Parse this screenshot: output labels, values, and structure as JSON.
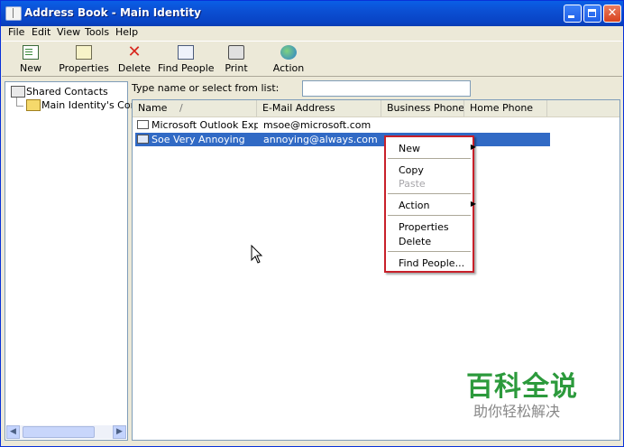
{
  "window": {
    "title": "Address Book - Main Identity"
  },
  "menubar": {
    "items": [
      "File",
      "Edit",
      "View",
      "Tools",
      "Help"
    ]
  },
  "toolbar": {
    "buttons": [
      {
        "label": "New",
        "icon": "new-contact-icon"
      },
      {
        "label": "Properties",
        "icon": "properties-icon"
      },
      {
        "label": "Delete",
        "icon": "delete-icon"
      },
      {
        "label": "Find People",
        "icon": "find-people-icon"
      },
      {
        "label": "Print",
        "icon": "print-icon"
      },
      {
        "label": "Action",
        "icon": "action-icon"
      }
    ]
  },
  "tree": {
    "items": [
      "Shared Contacts",
      "Main Identity's Conta"
    ]
  },
  "search": {
    "label": "Type name or select from list:",
    "value": ""
  },
  "list": {
    "columns": [
      "Name",
      "E-Mail Address",
      "Business Phone",
      "Home Phone"
    ],
    "sort_indicator": "/",
    "rows": [
      {
        "name": "Microsoft Outlook Expr...",
        "email": "msoe@microsoft.com",
        "business_phone": "",
        "home_phone": "",
        "selected": false
      },
      {
        "name": "Soe Very Annoying",
        "email": "annoying@always.com",
        "business_phone": "",
        "home_phone": "",
        "selected": true
      }
    ]
  },
  "context_menu": {
    "highlight_color": "#c8202a",
    "items": {
      "new": "New",
      "copy": "Copy",
      "paste": "Paste",
      "action": "Action",
      "properties": "Properties",
      "delete": "Delete",
      "find_people": "Find People..."
    }
  },
  "watermark": {
    "main": "百科全说",
    "sub": "助你轻松解决"
  },
  "colors": {
    "titlebar": "#0b4fd3",
    "selection": "#316ac5",
    "menu_border": "#c8202a",
    "watermark": "#2c9a3c"
  }
}
